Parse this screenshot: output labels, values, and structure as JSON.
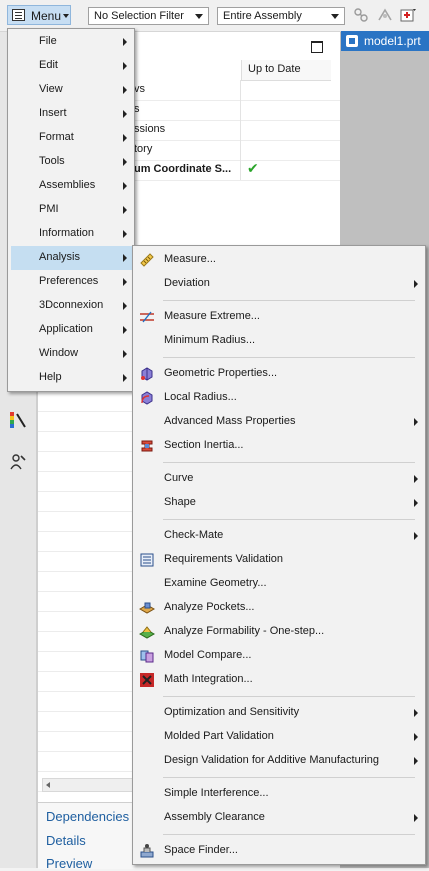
{
  "toolbar": {
    "menu_label": "Menu",
    "selection_filter": "No Selection Filter",
    "scope": "Entire Assembly"
  },
  "document": {
    "tab_label": "model1.prt"
  },
  "navigator": {
    "column_header": "Up to Date",
    "rows": [
      {
        "text": "vs"
      },
      {
        "text": "s"
      },
      {
        "text": "ssions"
      },
      {
        "text": "tory"
      },
      {
        "text": "um Coordinate S...",
        "bold": true,
        "up_to_date": "✔"
      }
    ],
    "bottom_tabs": [
      "Dependencies",
      "Details",
      "Preview"
    ]
  },
  "main_menu": {
    "items": [
      {
        "label": "File"
      },
      {
        "label": "Edit"
      },
      {
        "label": "View"
      },
      {
        "label": "Insert"
      },
      {
        "label": "Format"
      },
      {
        "label": "Tools"
      },
      {
        "label": "Assemblies"
      },
      {
        "label": "PMI"
      },
      {
        "label": "Information"
      },
      {
        "label": "Analysis",
        "highlighted": true
      },
      {
        "label": "Preferences"
      },
      {
        "label": "3Dconnexion"
      },
      {
        "label": "Application"
      },
      {
        "label": "Window"
      },
      {
        "label": "Help"
      }
    ]
  },
  "analysis_menu": {
    "items": [
      {
        "label": "Measure...",
        "icon": "measure-icon"
      },
      {
        "label": "Deviation",
        "submenu": true
      },
      {
        "label": "Measure Extreme...",
        "icon": "measure-extreme-icon"
      },
      {
        "label": "Minimum Radius..."
      },
      {
        "label": "Geometric Properties...",
        "icon": "geometric-properties-icon"
      },
      {
        "label": "Local Radius...",
        "icon": "local-radius-icon"
      },
      {
        "label": "Advanced Mass Properties",
        "submenu": true
      },
      {
        "label": "Section Inertia...",
        "icon": "section-inertia-icon"
      },
      {
        "label": "Curve",
        "submenu": true
      },
      {
        "label": "Shape",
        "submenu": true
      },
      {
        "label": "Check-Mate",
        "submenu": true
      },
      {
        "label": "Requirements Validation",
        "icon": "requirements-validation-icon"
      },
      {
        "label": "Examine Geometry..."
      },
      {
        "label": "Analyze Pockets...",
        "icon": "analyze-pockets-icon"
      },
      {
        "label": "Analyze Formability - One-step...",
        "icon": "analyze-formability-icon"
      },
      {
        "label": "Model Compare...",
        "icon": "model-compare-icon"
      },
      {
        "label": "Math Integration...",
        "icon": "math-integration-icon"
      },
      {
        "label": "Optimization and Sensitivity",
        "submenu": true
      },
      {
        "label": "Molded Part Validation",
        "submenu": true
      },
      {
        "label": "Design Validation for Additive Manufacturing",
        "submenu": true
      },
      {
        "label": "Simple Interference..."
      },
      {
        "label": "Assembly Clearance",
        "submenu": true
      },
      {
        "label": "Space Finder...",
        "icon": "space-finder-icon"
      }
    ]
  }
}
